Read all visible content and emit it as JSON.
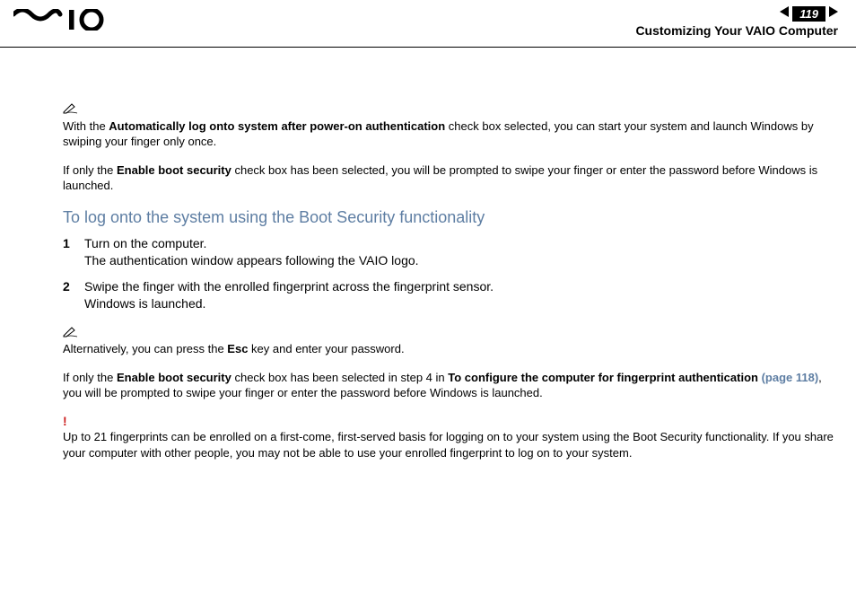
{
  "header": {
    "page_number": "119",
    "title": "Customizing Your VAIO Computer"
  },
  "intro": {
    "note1_prefix": "With the ",
    "note1_bold": "Automatically log onto system after power-on authentication",
    "note1_suffix": " check box selected, you can start your system and launch Windows by swiping your finger only once.",
    "note2_prefix": "If only the ",
    "note2_bold": "Enable boot security",
    "note2_suffix": " check box has been selected, you will be prompted to swipe your finger or enter the password before Windows is launched."
  },
  "section_title": "To log onto the system using the Boot Security functionality",
  "steps": [
    {
      "num": "1",
      "line1": "Turn on the computer.",
      "line2": "The authentication window appears following the VAIO logo."
    },
    {
      "num": "2",
      "line1": "Swipe the finger with the enrolled fingerprint across the fingerprint sensor.",
      "line2": "Windows is launched."
    }
  ],
  "notes": {
    "alt_prefix": "Alternatively, you can press the ",
    "alt_bold": "Esc",
    "alt_suffix": " key and enter your password.",
    "if_prefix": "If only the ",
    "if_bold1": "Enable boot security",
    "if_mid": " check box has been selected in step 4 in ",
    "if_bold2": "To configure the computer for fingerprint authentication ",
    "if_link": "(page 118)",
    "if_suffix": ", you will be prompted to swipe your finger or enter the password before Windows is launched.",
    "warn": "Up to 21 fingerprints can be enrolled on a first-come, first-served basis for logging on to your system using the Boot Security functionality. If you share your computer with other people, you may not be able to use your enrolled fingerprint to log on to your system."
  }
}
